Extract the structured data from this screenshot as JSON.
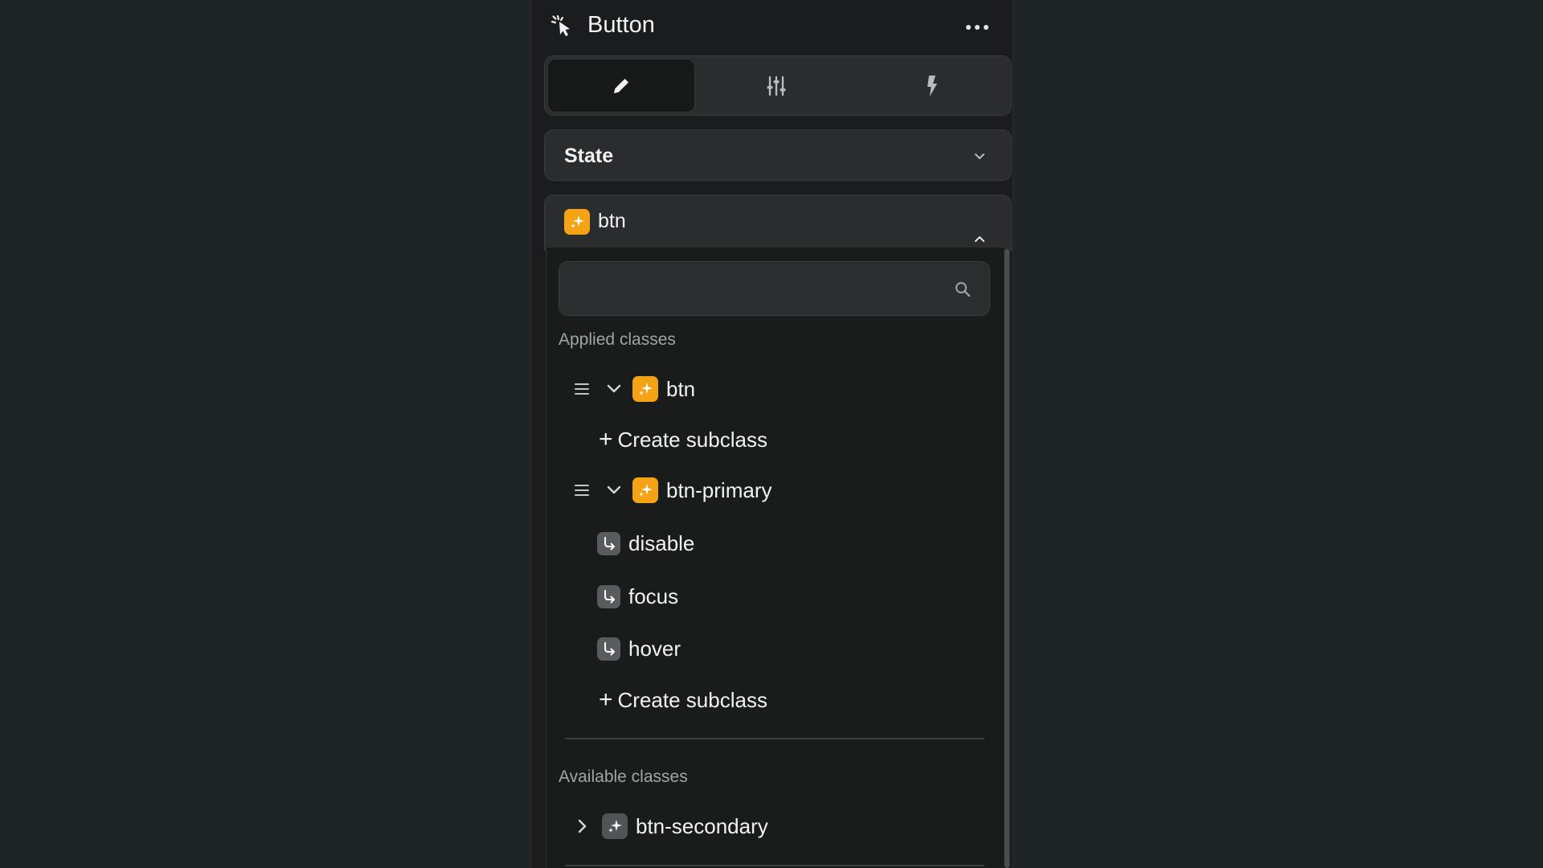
{
  "header": {
    "title": "Button",
    "title_icon": "cursor-click-icon",
    "more_icon": "more-horizontal-icon"
  },
  "tabs": [
    {
      "name": "style",
      "icon": "pencil-icon",
      "active": true
    },
    {
      "name": "settings",
      "icon": "sliders-icon",
      "active": false
    },
    {
      "name": "interactions",
      "icon": "lightning-icon",
      "active": false
    }
  ],
  "state": {
    "label": "State",
    "icon": "chevron-down-icon"
  },
  "selected_class": {
    "name": "btn",
    "icon": "sparkle-icon",
    "toggle_icon": "chevron-up-icon"
  },
  "search": {
    "value": "",
    "placeholder": "",
    "icon": "search-icon"
  },
  "applied": {
    "heading": "Applied classes",
    "classes": [
      {
        "name": "btn",
        "subclasses": [],
        "create_label": "Create subclass"
      },
      {
        "name": "btn-primary",
        "subclasses": [
          "disable",
          "focus",
          "hover"
        ],
        "create_label": "Create subclass"
      }
    ]
  },
  "available": {
    "heading": "Available classes",
    "classes": [
      {
        "name": "btn-secondary"
      }
    ]
  },
  "colors": {
    "background": "#1f2424",
    "panel": "#1a1c1d",
    "accent_badge": "#f5a316",
    "grey_badge": "#505456"
  }
}
